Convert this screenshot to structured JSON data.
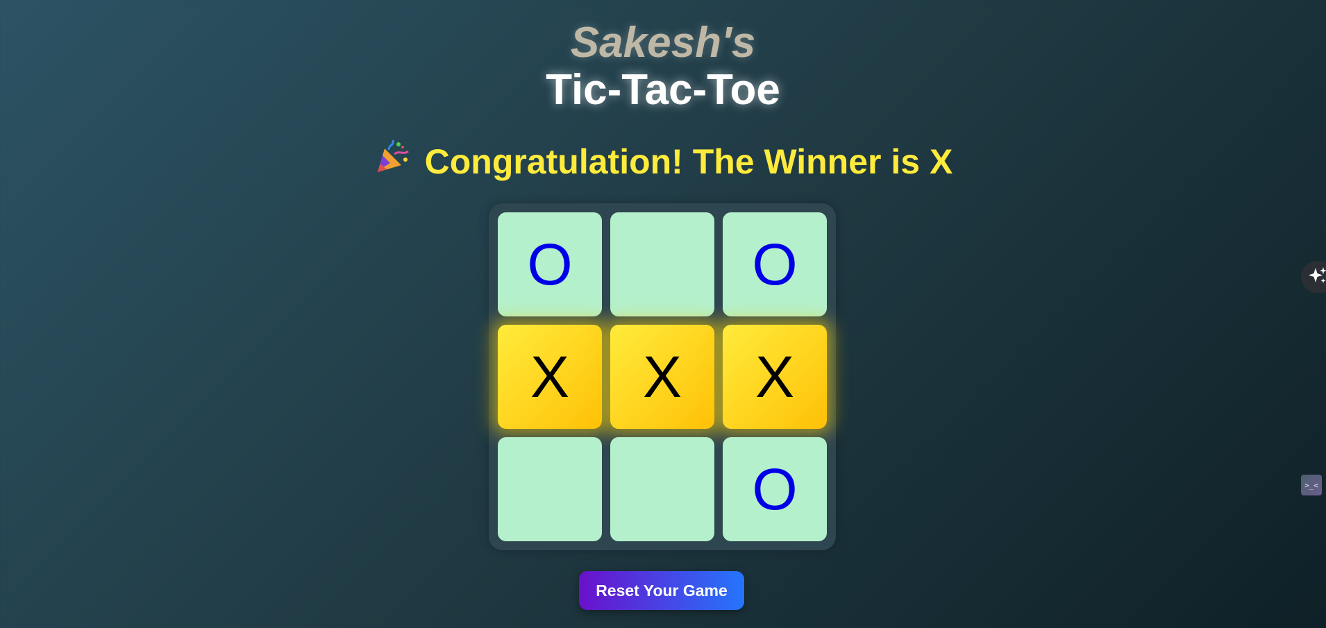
{
  "header": {
    "brand": "Sakesh's",
    "title": "Tic-Tac-Toe"
  },
  "status": {
    "icon": "party-popper-icon",
    "text": "Congratulation! The Winner is X"
  },
  "board": {
    "cells": [
      "O",
      "",
      "O",
      "X",
      "X",
      "X",
      "",
      "",
      "O"
    ],
    "winning_cells": [
      3,
      4,
      5
    ]
  },
  "reset_label": "Reset Your Game",
  "colors": {
    "cell": "#b4f0cb",
    "winning_cell": "#ffc107",
    "o_mark": "#0000e6",
    "x_mark": "#000000",
    "status_text": "#ffeb3b"
  },
  "side_icons": [
    "sparkle-icon",
    "terminal-icon"
  ]
}
